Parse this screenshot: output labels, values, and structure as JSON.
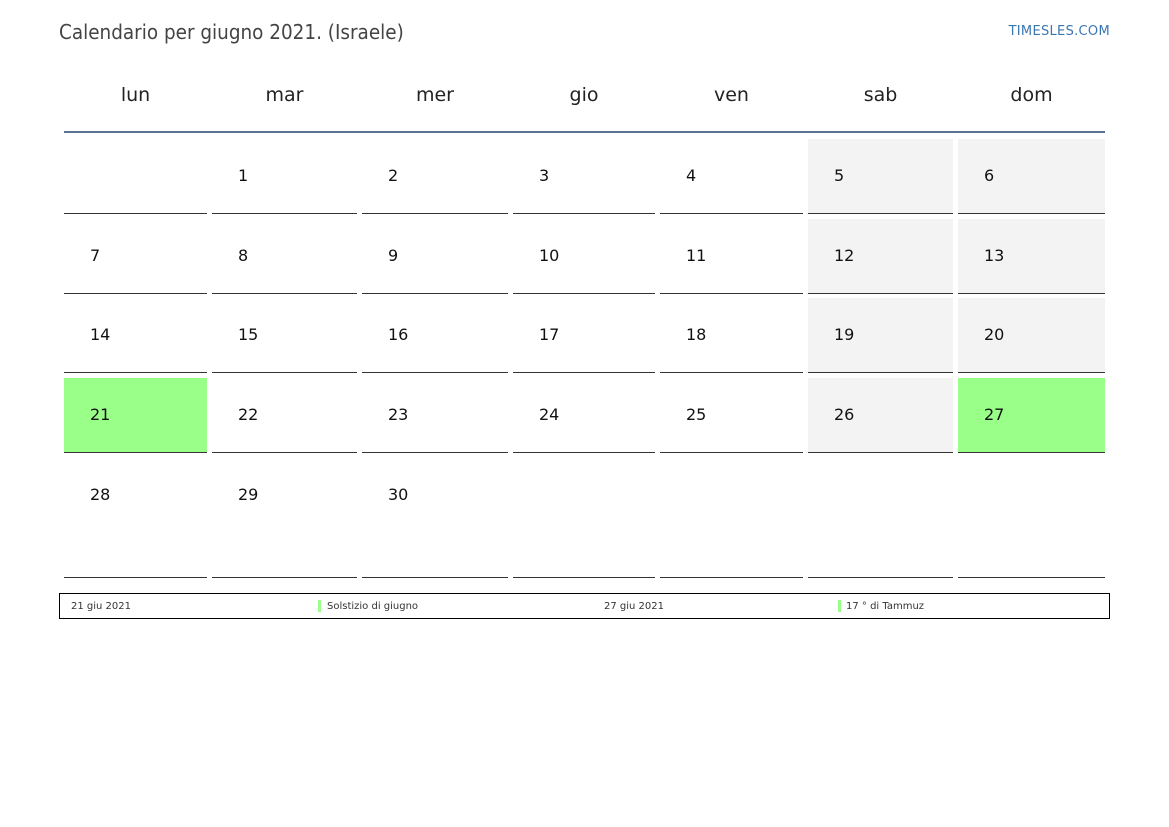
{
  "title": "Calendario per giugno 2021. (Israele)",
  "site": "TIMESLES.COM",
  "weekdays": [
    "lun",
    "mar",
    "mer",
    "gio",
    "ven",
    "sab",
    "dom"
  ],
  "colors": {
    "weekend": "#f3f3f3",
    "holiday": "#99ff88",
    "rule": "#5a7294",
    "link": "#3a76b0"
  },
  "weeks": [
    [
      "",
      "1",
      "2",
      "3",
      "4",
      "5",
      "6"
    ],
    [
      "7",
      "8",
      "9",
      "10",
      "11",
      "12",
      "13"
    ],
    [
      "14",
      "15",
      "16",
      "17",
      "18",
      "19",
      "20"
    ],
    [
      "21",
      "22",
      "23",
      "24",
      "25",
      "26",
      "27"
    ],
    [
      "28",
      "29",
      "30",
      "",
      "",
      "",
      ""
    ]
  ],
  "holidays": [
    "21",
    "27"
  ],
  "legend": [
    {
      "date": "21 giu 2021",
      "name": "Solstizio di giugno"
    },
    {
      "date": "27 giu 2021",
      "name": "17 ° di Tammuz"
    }
  ]
}
